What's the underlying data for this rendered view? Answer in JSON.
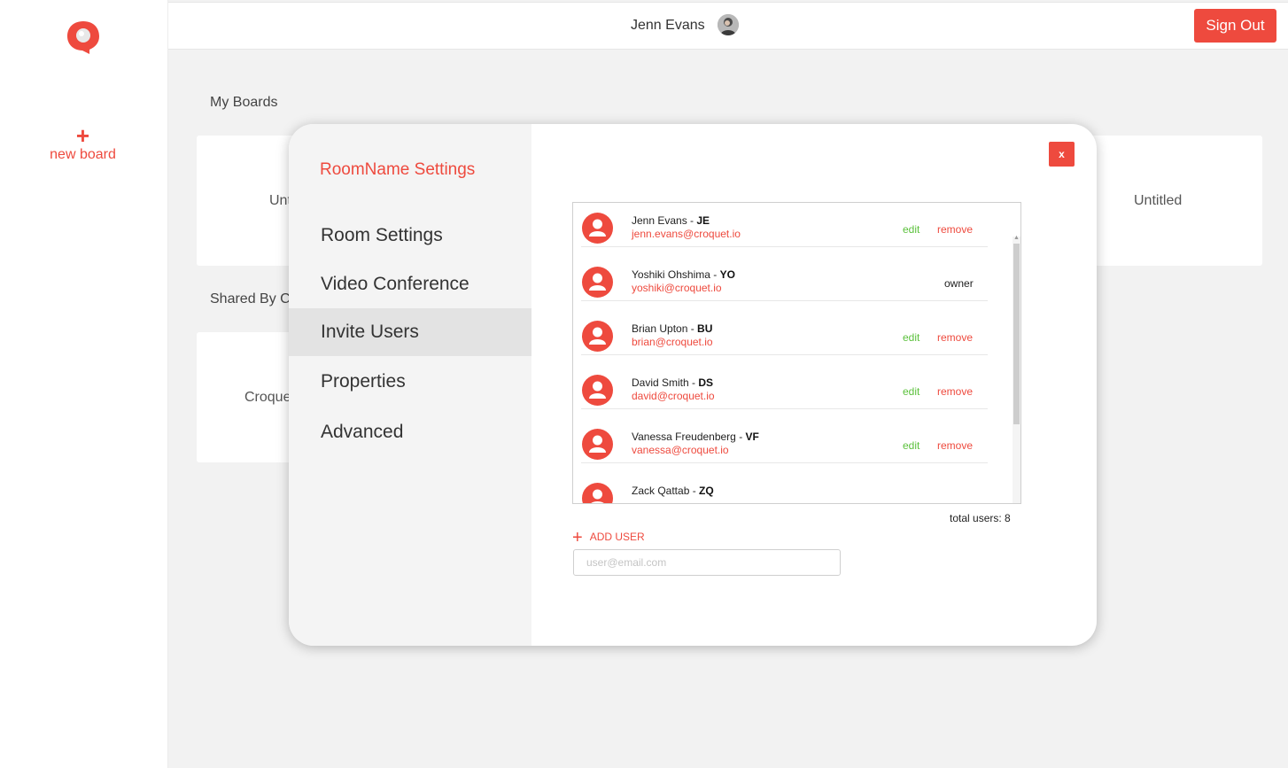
{
  "rail": {
    "new_board_label": "new board",
    "plus_icon": "+"
  },
  "topbar": {
    "user_name": "Jenn Evans",
    "sign_out": "Sign Out"
  },
  "background": {
    "my_boards_title": "My Boards",
    "shared_title": "Shared By Croquet",
    "board_titles": [
      "Untitled",
      "Untitled"
    ],
    "shared_board_titles": [
      "Croquet"
    ]
  },
  "modal": {
    "heading": "RoomName Settings",
    "close_label": "x",
    "menu": [
      "Room Settings",
      "Video Conference",
      "Invite Users",
      "Properties",
      "Advanced"
    ],
    "active_menu": "Invite Users",
    "users": [
      {
        "name": "Jenn Evans - ",
        "initials": "JE",
        "email": "jenn.evans@croquet.io",
        "edit": "edit",
        "remove": "remove"
      },
      {
        "name": "Yoshiki Ohshima - ",
        "initials": "YO",
        "email": "yoshiki@croquet.io",
        "role": "owner"
      },
      {
        "name": "Brian Upton - ",
        "initials": "BU",
        "email": "brian@croquet.io",
        "edit": "edit",
        "remove": "remove"
      },
      {
        "name": "David Smith - ",
        "initials": "DS",
        "email": "david@croquet.io",
        "edit": "edit",
        "remove": "remove"
      },
      {
        "name": "Vanessa Freudenberg - ",
        "initials": "VF",
        "email": "vanessa@croquet.io",
        "edit": "edit",
        "remove": "remove"
      },
      {
        "name": "Zack Qattab - ",
        "initials": "ZQ",
        "email": ""
      }
    ],
    "total_users": "total users: 8",
    "add_user": "ADD USER",
    "email_placeholder": "user@email.com"
  },
  "colors": {
    "accent": "#ee4a3e",
    "edit": "#5cc13d"
  }
}
